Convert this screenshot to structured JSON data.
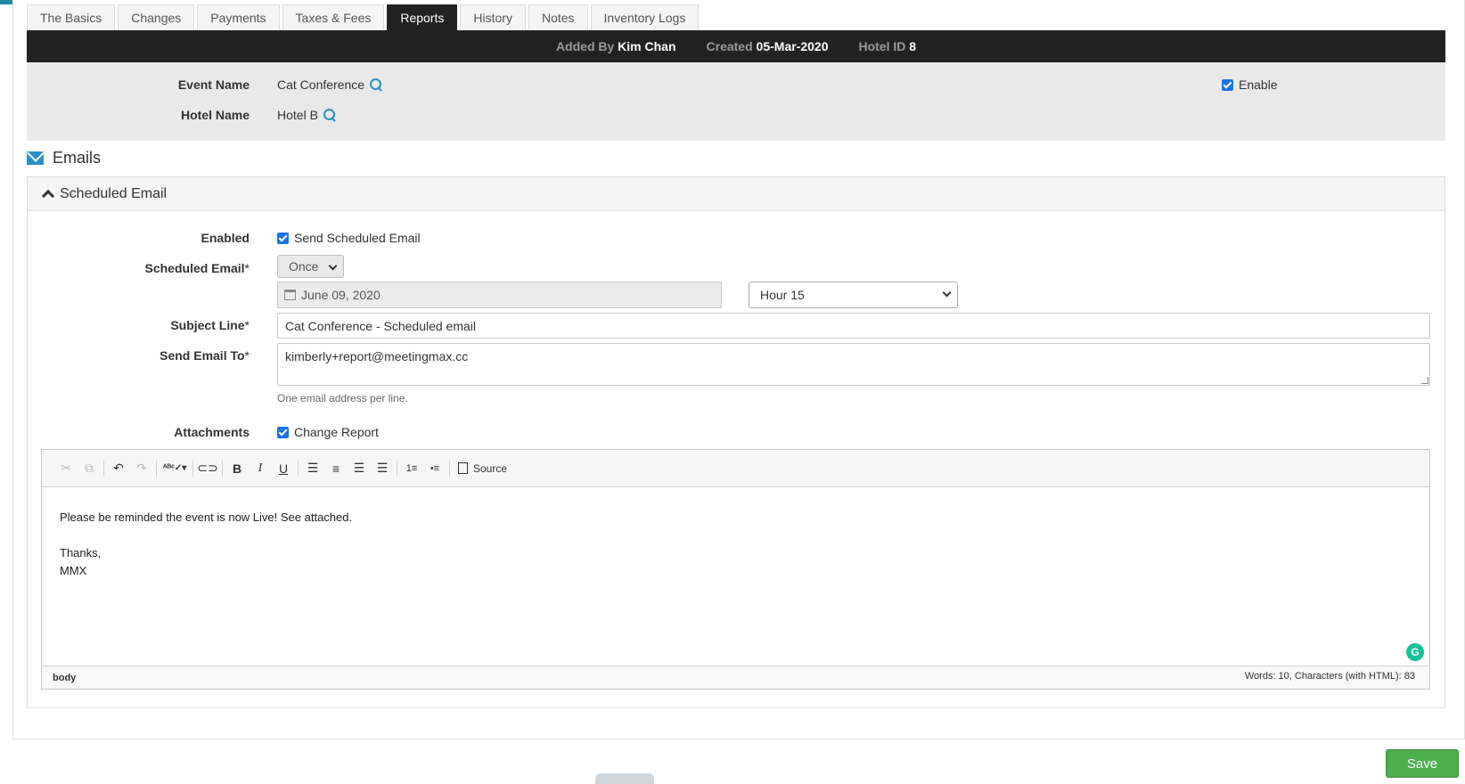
{
  "tabs": [
    "The Basics",
    "Changes",
    "Payments",
    "Taxes & Fees",
    "Reports",
    "History",
    "Notes",
    "Inventory Logs"
  ],
  "active_tab": "Reports",
  "info_bar": {
    "added_by_label": "Added By",
    "added_by_value": "Kim Chan",
    "created_label": "Created",
    "created_value": "05-Mar-2020",
    "hotel_id_label": "Hotel ID",
    "hotel_id_value": "8"
  },
  "event": {
    "event_name_label": "Event Name",
    "event_name_value": "Cat Conference",
    "hotel_name_label": "Hotel Name",
    "hotel_name_value": "Hotel B",
    "enable_label": "Enable"
  },
  "emails": {
    "section_title": "Emails",
    "panel_title": "Scheduled Email",
    "enabled_label": "Enabled",
    "enabled_checkbox_label": "Send Scheduled Email",
    "scheduled_email_label": "Scheduled Email",
    "frequency_value": "Once",
    "date_value": "June 09, 2020",
    "hour_value": "Hour 15",
    "subject_label": "Subject Line",
    "subject_value": "Cat Conference - Scheduled email",
    "send_to_label": "Send Email To",
    "send_to_value": "kimberly+report@meetingmax.cc",
    "send_to_help": "One email address per line.",
    "attachments_label": "Attachments",
    "attachment_checkbox_label": "Change Report",
    "required_mark": "*"
  },
  "editor": {
    "source_label": "Source",
    "body_lines": [
      "Please be reminded the event is now Live! See attached.",
      "Thanks,",
      "MMX"
    ],
    "path": "body",
    "count": "Words: 10, Characters (with HTML): 83",
    "toolbar_icons": [
      "cut-icon",
      "copy-icon",
      "undo-icon",
      "redo-icon",
      "spellcheck-icon",
      "link-icon",
      "bold-icon",
      "italic-icon",
      "underline-icon",
      "align-left-icon",
      "align-center-icon",
      "align-right-icon",
      "justify-icon",
      "numbered-list-icon",
      "bulleted-list-icon",
      "source-icon"
    ]
  },
  "save_label": "Save",
  "colors": {
    "accent": "#1f8ba5",
    "link_icon": "#2a8fc9",
    "save": "#4cae4c",
    "dark_bar": "#222222"
  }
}
